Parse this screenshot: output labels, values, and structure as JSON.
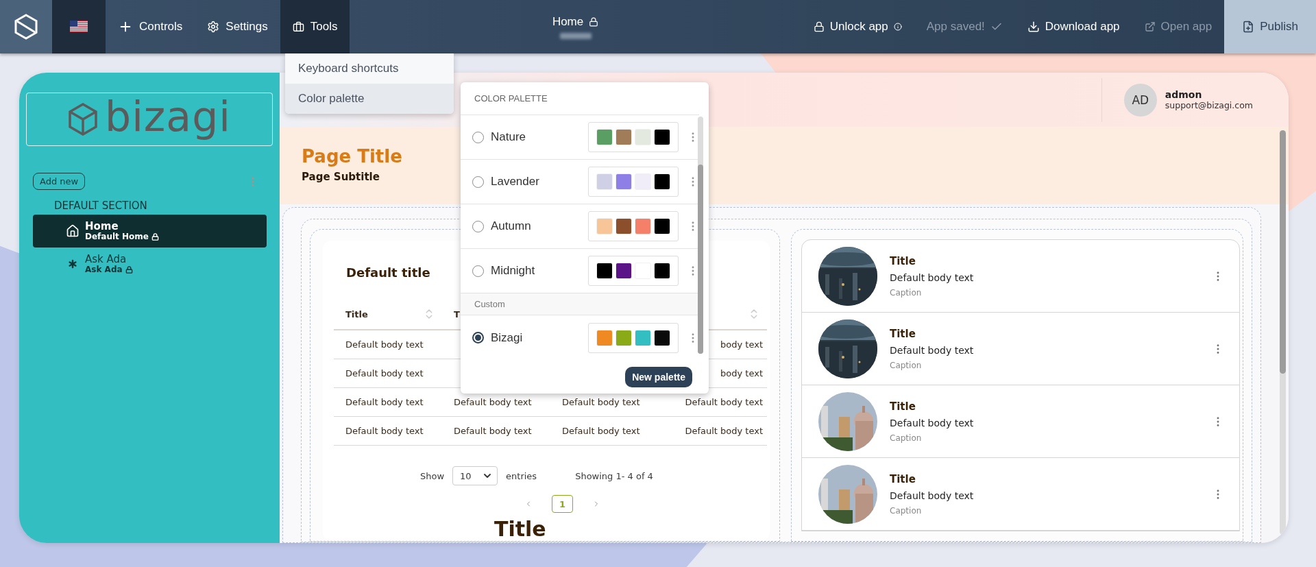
{
  "topbar": {
    "nav": [
      {
        "label": "Controls",
        "kind": "plus",
        "selected": false
      },
      {
        "label": "Settings",
        "kind": "gear",
        "selected": false
      },
      {
        "label": "Tools",
        "kind": "toolbox",
        "selected": true
      }
    ],
    "title": "Home",
    "title_locked": true,
    "actions": [
      {
        "label": "Unlock app",
        "kind": "lock",
        "info": true,
        "disabled": false
      },
      {
        "label": "App saved!",
        "kind": "saved",
        "info": false,
        "disabled": true
      },
      {
        "label": "Download app",
        "kind": "download",
        "info": false,
        "disabled": false
      },
      {
        "label": "Open app",
        "kind": "open",
        "info": false,
        "disabled": true
      },
      {
        "label": "Publish",
        "kind": "publish",
        "info": false,
        "disabled": false
      }
    ]
  },
  "tools_menu": {
    "items": [
      {
        "label": "Keyboard shortcuts",
        "selected": false
      },
      {
        "label": "Color palette",
        "selected": true
      }
    ]
  },
  "color_palette": {
    "title": "COLOR PALETTE",
    "groups": [
      {
        "palettes": [
          {
            "name": "Nature",
            "selected": false,
            "swatches": [
              {
                "color": "#5a9e64"
              },
              {
                "color": "#a07c58"
              },
              {
                "color": "#e3e9df"
              },
              {
                "color": "#000000"
              }
            ]
          },
          {
            "name": "Lavender",
            "selected": false,
            "swatches": [
              {
                "color": "#cfcfe6"
              },
              {
                "color": "#8e7fe6"
              },
              {
                "color": "#f0ecf8"
              },
              {
                "color": "#000000"
              }
            ]
          },
          {
            "name": "Autumn",
            "selected": false,
            "swatches": [
              {
                "color": "#f7c598"
              },
              {
                "color": "#8b4f2b"
              },
              {
                "color": "#f5806a"
              },
              {
                "color": "#000000"
              }
            ]
          },
          {
            "name": "Midnight",
            "selected": false,
            "swatches": [
              {
                "color": "#000000"
              },
              {
                "color": "#5a1487"
              },
              {
                "color": "#ffffff"
              },
              {
                "color": "#000000"
              }
            ]
          }
        ]
      },
      {
        "label": "Custom",
        "palettes": [
          {
            "name": "Bizagi",
            "selected": true,
            "swatches": [
              {
                "color": "#ef8a23"
              },
              {
                "color": "#8aab17"
              },
              {
                "color": "#33bec1"
              },
              {
                "color": "#0a0a0a"
              }
            ]
          }
        ]
      }
    ],
    "button": "New palette"
  },
  "sidebar": {
    "logo": "bizagi",
    "add_button": "Add new",
    "section": "DEFAULT SECTION",
    "items": [
      {
        "label": "Home",
        "sublabel": "Default Home",
        "kind": "home",
        "locked": true,
        "selected": true
      },
      {
        "label": "Ask Ada",
        "sublabel": "Ask Ada",
        "kind": "asterisk",
        "locked": true,
        "selected": false
      }
    ]
  },
  "user": {
    "initials": "AD",
    "name": "admon",
    "email": "support@bizagi.com"
  },
  "page": {
    "title": "Page Title",
    "subtitle": "Page Subtitle"
  },
  "table_card": {
    "title": "Default title",
    "columns": [
      {
        "column_1": "Title",
        "sortable": true
      },
      {
        "column_2": "T"
      },
      {},
      {
        "sortable": true
      }
    ],
    "rows": [
      {
        "column_1": "Default body text",
        "column_4": "body text"
      },
      {
        "column_1": "Default body text",
        "column_4": "body text"
      },
      {
        "column_1": "Default body text",
        "column_2": "Default body text",
        "column_3": "Default body text",
        "column_4": "Default body text"
      },
      {
        "column_1": "Default body text",
        "column_2": "Default body text",
        "column_3": "Default body text",
        "column_4": "Default body text"
      }
    ],
    "show_label": "Show",
    "page_size": "10",
    "entries_label": "entries",
    "summary": "Showing 1- 4 of 4",
    "pages": [
      {
        "label": "1",
        "selected": true
      }
    ]
  },
  "section_title": "Title",
  "list": [
    {
      "title": "Title",
      "body": "Default body text",
      "caption": "Caption"
    },
    {
      "title": "Title",
      "body": "Default body text",
      "caption": "Caption"
    },
    {
      "title": "Title",
      "body": "Default body text",
      "caption": "Caption"
    },
    {
      "title": "Title",
      "body": "Default body text",
      "caption": "Caption"
    }
  ]
}
